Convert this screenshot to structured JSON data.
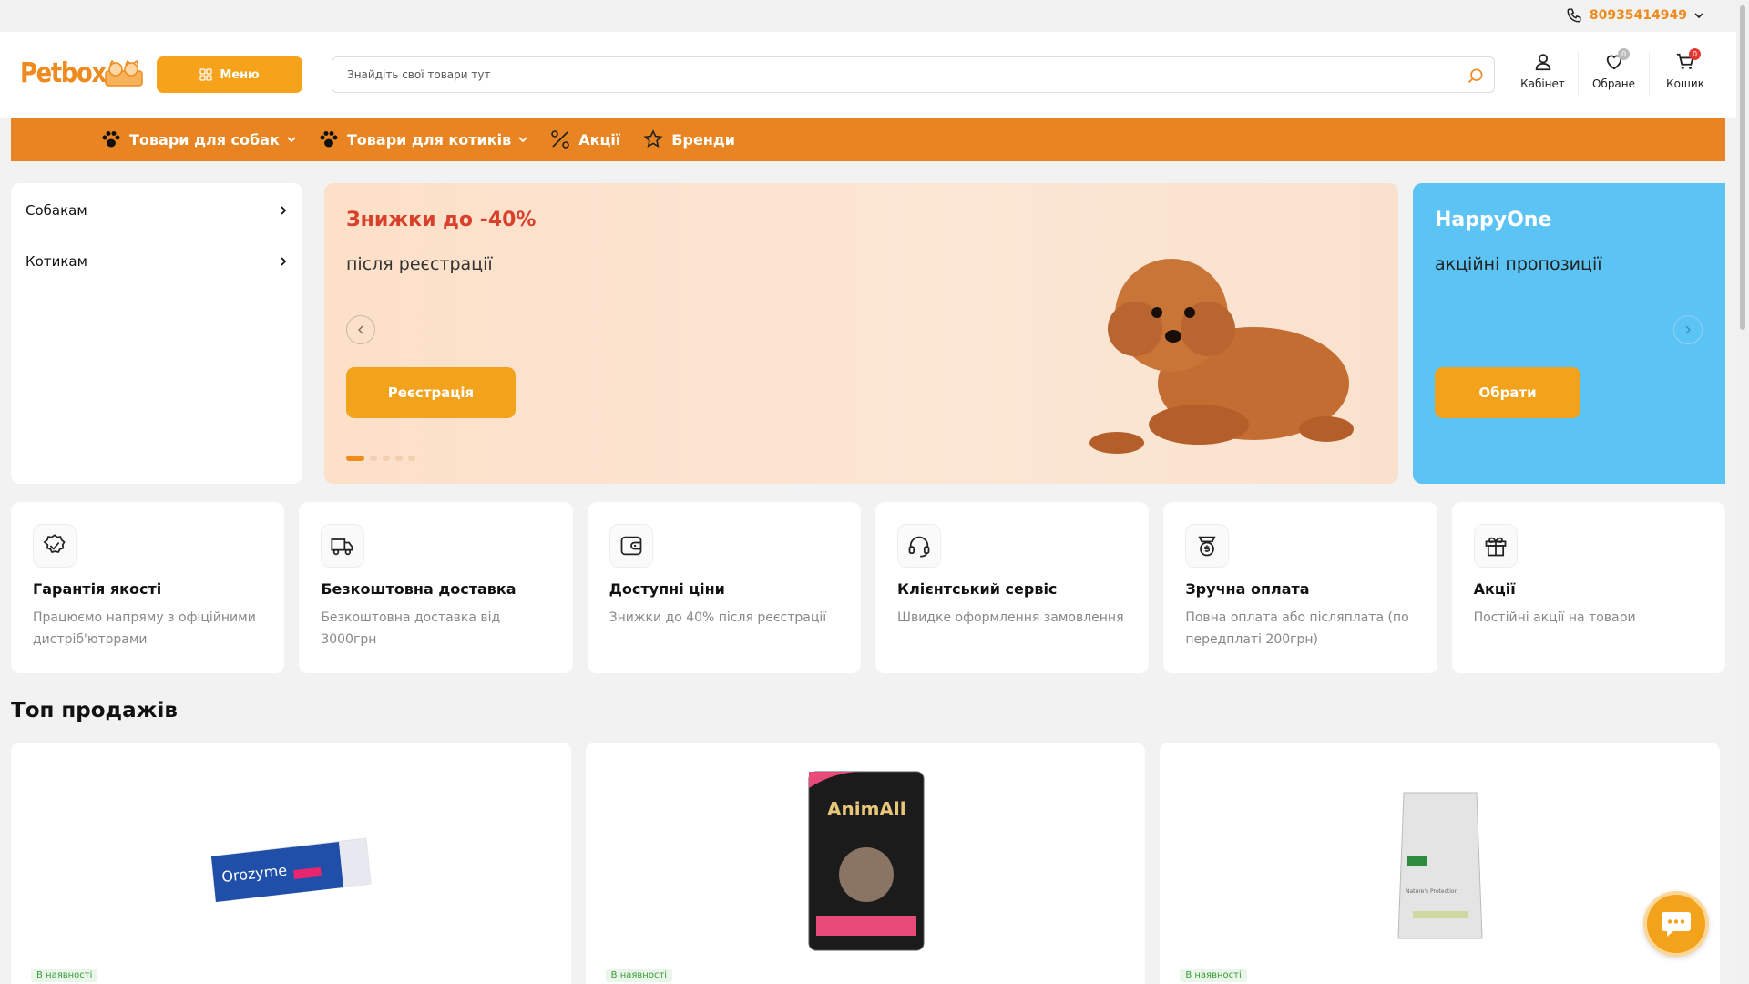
{
  "topbar": {
    "phone": "80935414949"
  },
  "header": {
    "logo": "Petbox",
    "menu_label": "Меню",
    "search_placeholder": "Знайдіть свої товари тут",
    "account_label": "Кабінет",
    "favorites_label": "Обране",
    "favorites_count": "0",
    "cart_label": "Кошик",
    "cart_count": "0"
  },
  "nav": {
    "items": [
      {
        "label": "Товари для собак"
      },
      {
        "label": "Товари для котиків"
      },
      {
        "label": "Акції"
      },
      {
        "label": "Бренди"
      }
    ]
  },
  "sidebar": {
    "items": [
      {
        "label": "Собакам"
      },
      {
        "label": "Котикам"
      }
    ]
  },
  "banner": {
    "title": "Знижки до -40%",
    "subtitle": "після реєстрації",
    "button": "Реєстрація"
  },
  "banner2": {
    "title": "HappyOne",
    "subtitle": "акційні пропозиції",
    "button": "Обрати"
  },
  "features": [
    {
      "icon": "badge-check-icon",
      "title": "Гарантія якості",
      "text": "Працюємо напряму з офіційними дистріб'юторами"
    },
    {
      "icon": "truck-icon",
      "title": "Безкоштовна доставка",
      "text": "Безкоштовна доставка від 3000грн"
    },
    {
      "icon": "wallet-icon",
      "title": "Доступні ціни",
      "text": "Знижки до 40% після реєстрації"
    },
    {
      "icon": "headset-icon",
      "title": "Клієнтський сервіс",
      "text": "Швидке оформлення замовлення"
    },
    {
      "icon": "money-icon",
      "title": "Зручна оплата",
      "text": "Повна оплата або післяплата (по передплаті 200грн)"
    },
    {
      "icon": "gift-icon",
      "title": "Акції",
      "text": "Постійні акції на товари"
    }
  ],
  "top_sales": {
    "title": "Топ продажів",
    "products": [
      {
        "stock": "В наявності",
        "image_text": "Orozyme"
      },
      {
        "stock": "В наявності",
        "image_text": "AnimAll"
      },
      {
        "stock": "В наявності",
        "image_text": "Nature's Protection"
      }
    ]
  },
  "colors": {
    "accent": "#e88522",
    "button": "#f3a21c",
    "promo": "#d8402b",
    "blue_banner": "#5cc3f5"
  }
}
